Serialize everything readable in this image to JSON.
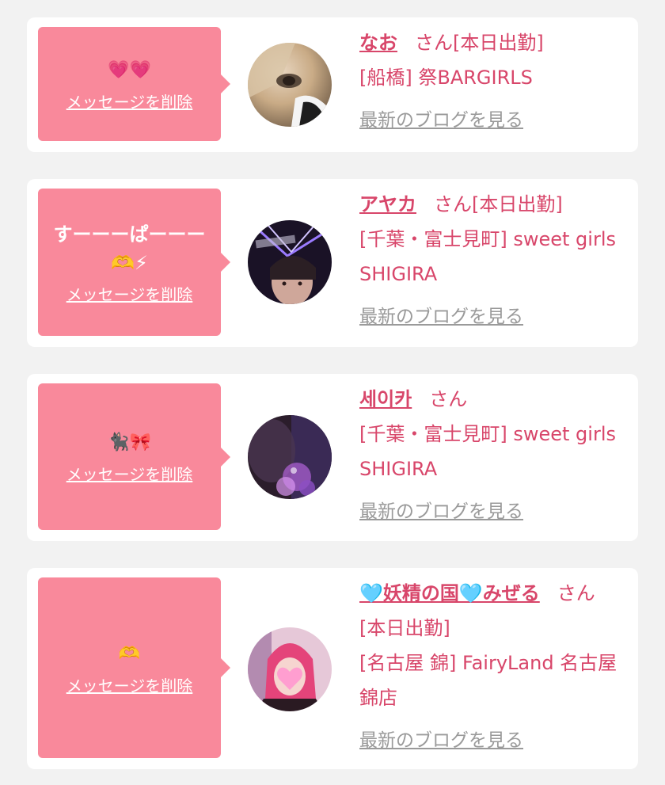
{
  "colors": {
    "bubble": "#f9899b",
    "accent": "#d8466a",
    "muted": "#9a9a9a",
    "page_bg": "#f2f2f2"
  },
  "delete_label": "メッセージを削除",
  "blog_label": "最新のブログを見る",
  "items": [
    {
      "message": "💗💗",
      "name": "なお",
      "suffix": "さん[本日出勤]",
      "shop": "[船橋] 祭BARGIRLS",
      "avatar": "blonde-hair-photo"
    },
    {
      "message": "すーーーぱーーー🫶⚡",
      "name": "アヤカ",
      "suffix": "さん[本日出勤]",
      "shop": "[千葉・富士見町] sweet girls SHIGIRA",
      "avatar": "neon-room-photo"
    },
    {
      "message": "🐈‍⬛🎀",
      "name": "세이카",
      "suffix": "さん",
      "shop": "[千葉・富士見町] sweet girls SHIGIRA",
      "avatar": "sparkle-photo"
    },
    {
      "message": "🫶",
      "name": "🩵妖精の国🩵みぜる",
      "suffix": "さん[本日出勤]",
      "shop": "[名古屋 錦] FairyLand 名古屋錦店",
      "avatar": "pink-hair-photo"
    }
  ]
}
